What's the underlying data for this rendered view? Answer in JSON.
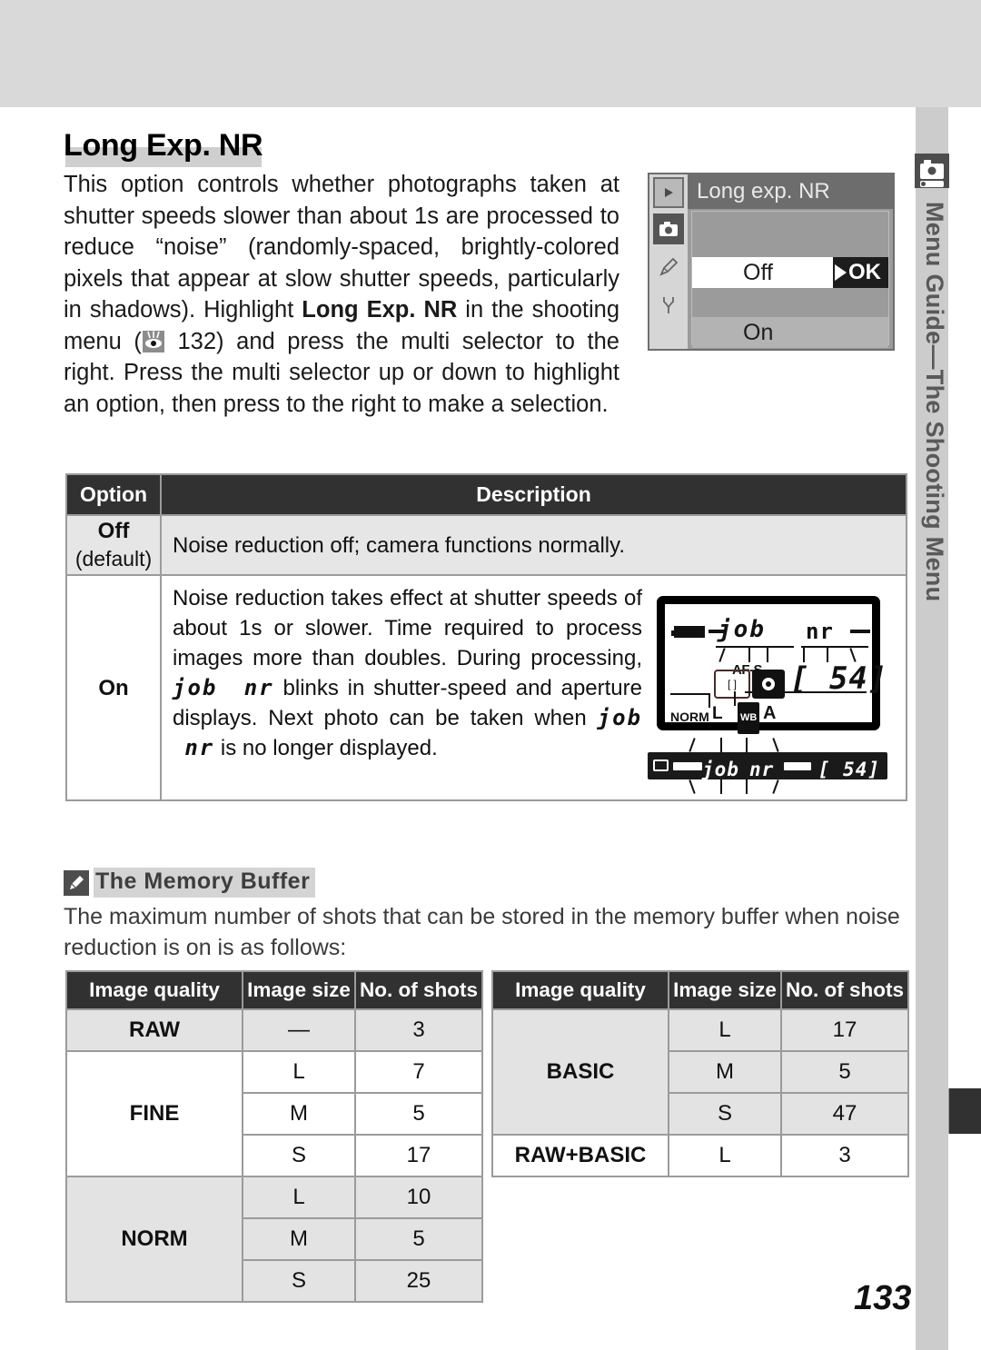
{
  "page": {
    "number": "133",
    "side_tab_label": "Menu Guide—The Shooting Menu",
    "side_tab_icon": "camera-icon"
  },
  "title": "Long Exp. NR",
  "intro": {
    "part1": "This option controls whether photographs taken at shutter speeds slower than about 1s are processed to reduce “noise” (randomly-spaced, brightly-colored pixels that appear at slow shutter speeds, particularly in shadows).  Highlight ",
    "bold1": "Long Exp. NR",
    "part2": " in the shooting menu (",
    "ref_icon": "eye-reference-icon",
    "ref_page": " 132) and press the multi selector to the right.  Press the multi selector up or down to highlight an option, then press to the right to make a selection."
  },
  "lcd_menu": {
    "title": "Long exp. NR",
    "selected_option": "Off",
    "ok_label": "OK",
    "other_option": "On",
    "sidebar_icons": [
      "playback-icon",
      "shooting-menu-icon",
      "custom-settings-pencil-icon",
      "setup-wrench-icon"
    ]
  },
  "option_table": {
    "headers": [
      "Option",
      "Description"
    ],
    "rows": [
      {
        "option": "Off",
        "option_sub": "(default)",
        "description": "Noise reduction off; camera functions normally."
      },
      {
        "option": "On",
        "desc_line1": "Noise reduction takes effect at shutter speeds of about 1s or slower.  Time required to process images more than doubles.  During processing,",
        "seg1": "job",
        "seg2": "nr",
        "desc_line2": " blinks in shutter-speed and aperture displays.  Next photo can be taken when",
        "seg3": "job",
        "seg4": "nr",
        "desc_line3": " is no longer displayed."
      }
    ]
  },
  "control_panel": {
    "segment_job": "job",
    "segment_nr": "nr",
    "af_mode": "AF-S",
    "shots_remaining": "54",
    "quality": "NORM",
    "size": "L",
    "wb_badge": "WB",
    "wb_mode": "A"
  },
  "viewfinder": {
    "segment_job": "job",
    "segment_nr": "nr",
    "shots_remaining": "54"
  },
  "note": {
    "heading": "The Memory Buffer",
    "heading_icon": "pencil-icon",
    "body": "The maximum number of shots that can be stored in the memory buffer when noise reduction is on is as follows:"
  },
  "buffer_tables": {
    "headers": [
      "Image quality",
      "Image size",
      "No. of shots"
    ],
    "left": [
      {
        "quality": "RAW",
        "rowspan": 1,
        "sizes": [
          "—"
        ],
        "shots": [
          "3"
        ],
        "shaded": true
      },
      {
        "quality": "FINE",
        "rowspan": 3,
        "sizes": [
          "L",
          "M",
          "S"
        ],
        "shots": [
          "7",
          "5",
          "17"
        ],
        "shaded": false
      },
      {
        "quality": "NORM",
        "rowspan": 3,
        "sizes": [
          "L",
          "M",
          "S"
        ],
        "shots": [
          "10",
          "5",
          "25"
        ],
        "shaded": true
      }
    ],
    "right": [
      {
        "quality": "BASIC",
        "rowspan": 3,
        "sizes": [
          "L",
          "M",
          "S"
        ],
        "shots": [
          "17",
          "5",
          "47"
        ],
        "shaded": true
      },
      {
        "quality": "RAW+BASIC",
        "rowspan": 1,
        "sizes": [
          "L"
        ],
        "shots": [
          "3"
        ],
        "shaded": false
      }
    ]
  },
  "colors": {
    "band": "#d9d9d9",
    "tab": "#cccccc",
    "header_dark": "#313131",
    "shade": "#e3e3e3",
    "highlight": "#cfcfcf"
  }
}
